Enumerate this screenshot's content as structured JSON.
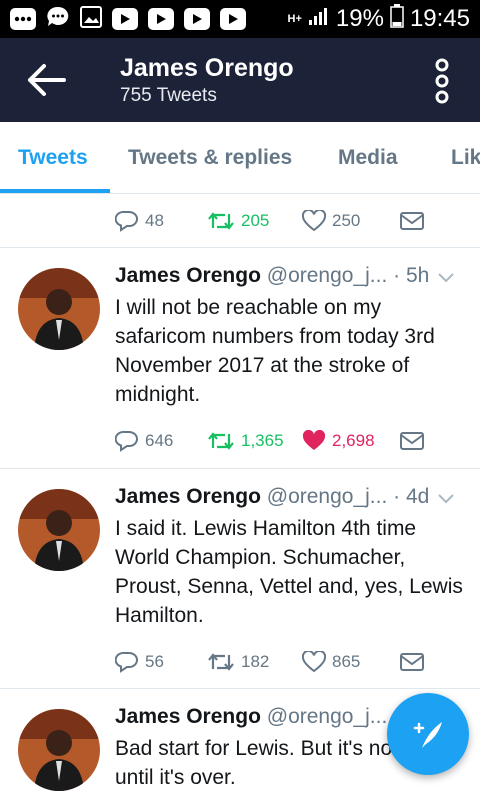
{
  "status_bar": {
    "network": "H+",
    "battery": "19%",
    "time": "19:45"
  },
  "header": {
    "title": "James Orengo",
    "subtitle": "755 Tweets"
  },
  "tabs": [
    {
      "label": "Tweets",
      "active": true
    },
    {
      "label": "Tweets & replies",
      "active": false
    },
    {
      "label": "Media",
      "active": false
    },
    {
      "label": "Likes",
      "active": false
    }
  ],
  "top_actions": {
    "replies": "48",
    "retweets": "205",
    "likes": "250"
  },
  "tweets": [
    {
      "name": "James Orengo",
      "handle": "@orengo_j...",
      "time": "· 5h",
      "text": "I will not be reachable on my safaricom numbers from today 3rd November 2017 at the stroke of midnight.",
      "replies": "646",
      "retweets": "1,365",
      "likes": "2,698",
      "liked": true,
      "retweeted": true
    },
    {
      "name": "James Orengo",
      "handle": "@orengo_j...",
      "time": "· 4d",
      "text": "I said it. Lewis Hamilton 4th time World Champion. Schumacher, Proust, Senna, Vettel and, yes, Lewis Hamilton.",
      "replies": "56",
      "retweets": "182",
      "likes": "865",
      "liked": false,
      "retweeted": false
    },
    {
      "name": "James Orengo",
      "handle": "@orengo_j...",
      "time": "",
      "text": "Bad start for Lewis. But it's not over until it's over."
    }
  ],
  "colors": {
    "appbar": "#1c2237",
    "accent": "#1da1f2",
    "retweet_green": "#17bf63",
    "like_red": "#e0245e"
  }
}
